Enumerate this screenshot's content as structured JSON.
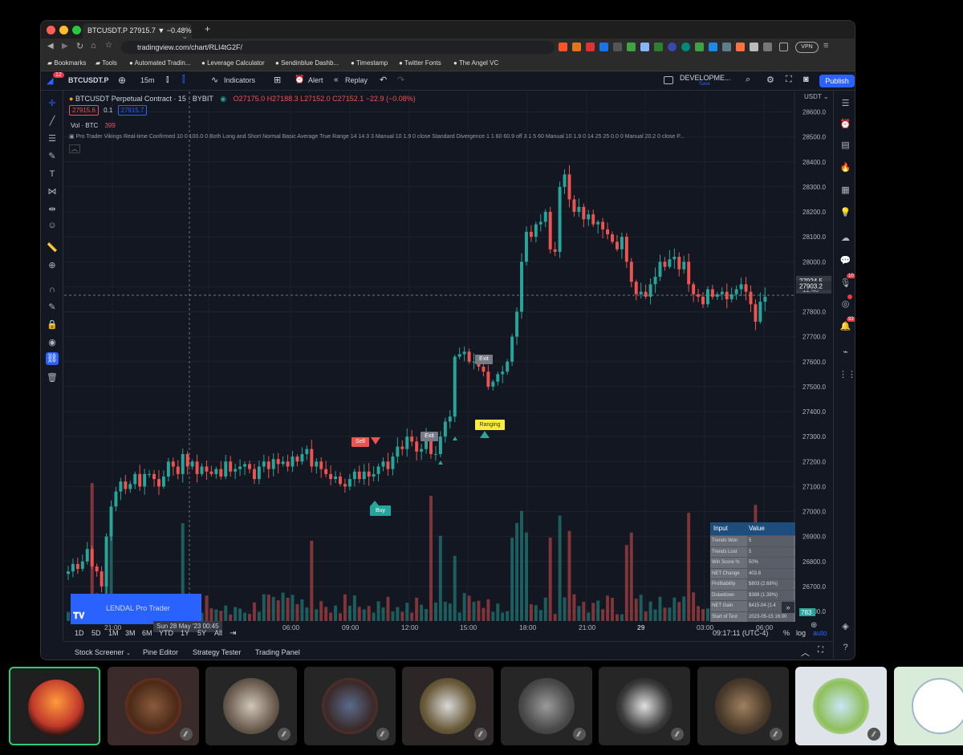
{
  "browser": {
    "tab_title": "BTCUSDT.P 27915.7 ▼ −0.48%",
    "new_tab": "+",
    "url": "tradingview.com/chart/RLI4tG2F/",
    "vpn": "VPN",
    "bookmarks": [
      "Bookmarks",
      "Tools",
      "Automated Tradin...",
      "Leverage Calculator",
      "Sendinblue Dashb...",
      "Timestamp",
      "Twitter Fonts",
      "The Angel VC"
    ]
  },
  "toolbar": {
    "notif_count": "12",
    "symbol": "BTCUSDT.P",
    "interval": "15m",
    "indicators": "Indicators",
    "alert": "Alert",
    "replay": "Replay",
    "layout_name": "DEVELOPME...",
    "layout_saved": "Save",
    "publish": "Publish"
  },
  "legend": {
    "title": "BTCUSDT Perpetual Contract · 15 · BYBIT",
    "ohlc": "O27175.0  H27188.3  L27152.0  C27152.1  −22.9 (−0.08%)",
    "bid": "27915.6",
    "spread": "0.1",
    "ask": "27915.7",
    "vol_label": "Vol · BTC",
    "vol_value": "399",
    "indicator_line": "Pro Trader Vikings Real-time Confirmed 10 0 100.0 0 Both Long and Short Normal Basic Average True Range 14 14 3 3 Manual 10 1.9 0 close Standard Divergence 1 1 60 60.9 off 3 1 5 60 Manual 10 1.9 0 14 25 25 0.0 0 Manual 20.2 0 close P..."
  },
  "price_axis": {
    "currency": "USDT",
    "ticks": [
      "28600.0",
      "28500.0",
      "28400.0",
      "28300.0",
      "28200.0",
      "28100.0",
      "28000.0",
      "27900.0",
      "27800.0",
      "27700.0",
      "27600.0",
      "27500.0",
      "27400.0",
      "27300.0",
      "27200.0",
      "27100.0",
      "27000.0",
      "26900.0",
      "26800.0",
      "26700.0",
      "26600.0"
    ],
    "last_price": "27924.5",
    "countdown": "12:40",
    "second_price": "27903.2",
    "volume_tag": "783"
  },
  "time_axis": {
    "ticks": [
      "21:00",
      "03:00",
      "06:00",
      "09:00",
      "12:00",
      "15:00",
      "18:00",
      "21:00",
      "29",
      "03:00",
      "06:00"
    ],
    "crosshair_time": "Sun 28 May '23   00:45"
  },
  "signals": {
    "sell": "Sell",
    "buy": "Buy",
    "exit1": "Exit",
    "exit2": "Exit",
    "ranging": "Ranging"
  },
  "watermark": "LENDAL Pro Trader",
  "stats_table": {
    "headers": [
      "Input",
      "Value"
    ],
    "rows": [
      [
        "Trends Won",
        "5"
      ],
      [
        "Trends Lost",
        "5"
      ],
      [
        "Win Score %",
        "50%"
      ],
      [
        "NET Change",
        "403.8"
      ],
      [
        "Profitability",
        "$803 (2.68%)"
      ],
      [
        "Drawdown",
        "$388 (1.39%)"
      ],
      [
        "NET Gain",
        "$415.04 (1.4"
      ],
      [
        "Start of Test",
        "2023-05-15 16:00"
      ]
    ]
  },
  "bottom": {
    "ranges": [
      "1D",
      "5D",
      "1M",
      "3M",
      "6M",
      "YTD",
      "1Y",
      "5Y",
      "All"
    ],
    "clock": "09:17:11 (UTC-4)",
    "percent": "%",
    "log": "log",
    "auto": "auto",
    "panels": [
      "Stock Screener",
      "Pine Editor",
      "Strategy Tester",
      "Trading Panel"
    ]
  },
  "colors": {
    "up": "#26a69a",
    "down": "#ef5350",
    "accent": "#2962ff",
    "bg": "#131722"
  },
  "participants": [
    "sunset-avatar",
    "warrior-avatar",
    "viking-elder-avatar",
    "painted-warrior-avatar",
    "white-hair-avatar",
    "bearded-viking-avatar",
    "suited-man-avatar",
    "crowned-viking-avatar",
    "cartoon-avatar",
    "whale-avatar"
  ],
  "chart_data": {
    "type": "candlestick",
    "symbol": "BTCUSDT.P",
    "interval": "15m",
    "ylim": [
      26600,
      28650
    ],
    "close_path": [
      26760,
      26790,
      26770,
      26800,
      26850,
      26780,
      26760,
      26700,
      26900,
      27020,
      27080,
      27120,
      27090,
      27110,
      27150,
      27100,
      27150,
      27150,
      27130,
      27100,
      27140,
      27200,
      27180,
      27150,
      27230,
      27180,
      27200,
      27150,
      27180,
      27160,
      27150,
      27170,
      27140,
      27200,
      27160,
      27170,
      27180,
      27190,
      27170,
      27130,
      27180,
      27200,
      27170,
      27210,
      27190,
      27200,
      27180,
      27220,
      27200,
      27230,
      27250,
      27180,
      27200,
      27170,
      27150,
      27130,
      27140,
      27110,
      27100,
      27130,
      27160,
      27130,
      27160,
      27140,
      27150,
      27180,
      27200,
      27170,
      27220,
      27260,
      27250,
      27300,
      27280,
      27240,
      27250,
      27300,
      27230,
      27230,
      27300,
      27360,
      27380,
      27620,
      27630,
      27640,
      27600,
      27600,
      27580,
      27560,
      27500,
      27520,
      27550,
      27560,
      27600,
      27700,
      27800,
      28000,
      28120,
      28100,
      28150,
      28160,
      28200,
      28050,
      28040,
      28300,
      28350,
      28250,
      28200,
      28220,
      28170,
      28190,
      28150,
      28160,
      28130,
      28110,
      28080,
      28050,
      28100,
      28000,
      27920,
      27870,
      27880,
      27860,
      27910,
      27940,
      28000,
      27980,
      28010,
      28020,
      27970,
      28000,
      27910,
      27870,
      27860,
      27830,
      27890,
      27860,
      27870,
      27880,
      27850,
      27870,
      27890,
      27910,
      27880,
      27830,
      27760,
      27840,
      27860
    ]
  }
}
